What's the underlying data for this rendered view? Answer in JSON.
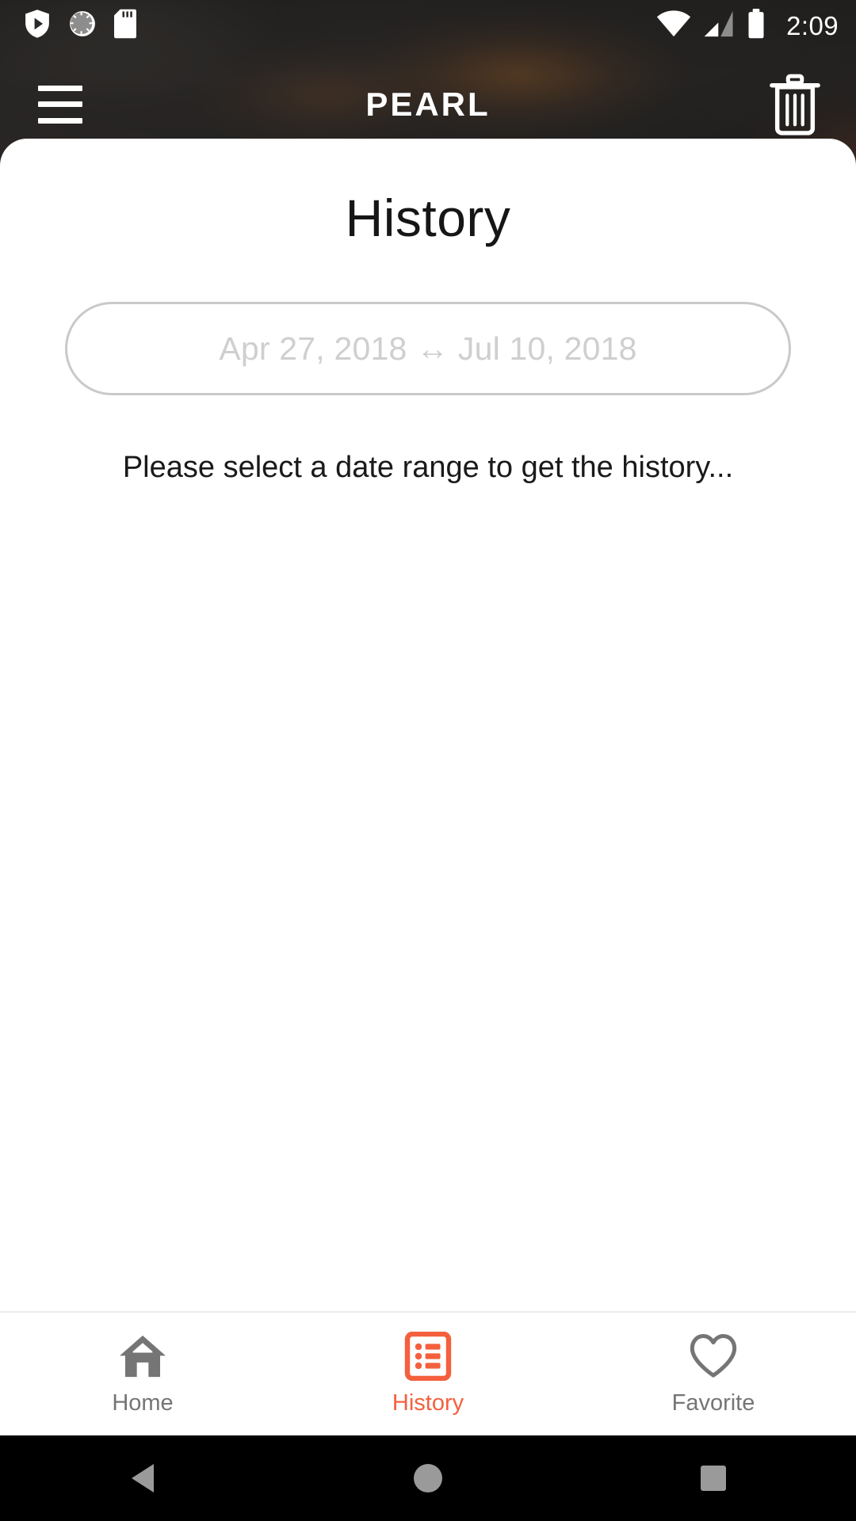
{
  "statusbar": {
    "time": "2:09",
    "icons_left": [
      "play-protect-icon",
      "sync-circle-icon",
      "sd-card-icon"
    ],
    "icons_right": [
      "wifi-icon",
      "cellular-signal-icon",
      "battery-icon"
    ]
  },
  "appbar": {
    "title": "PEARL",
    "menu_icon": "hamburger-menu-icon",
    "delete_icon": "trash-icon"
  },
  "main": {
    "page_title": "History",
    "date_range": {
      "value": "",
      "placeholder": "Apr 27, 2018 ↔ Jul 10, 2018"
    },
    "hint": "Please select a date range to get the history..."
  },
  "bottom_nav": {
    "items": [
      {
        "label": "Home",
        "icon": "home-icon",
        "active": false
      },
      {
        "label": "History",
        "icon": "list-icon",
        "active": true
      },
      {
        "label": "Favorite",
        "icon": "heart-icon",
        "active": false
      }
    ]
  },
  "system_nav": {
    "back": "back-triangle-icon",
    "home": "home-circle-icon",
    "recents": "recents-square-icon"
  },
  "colors": {
    "accent": "#f4603e",
    "header_bg": "#2b2927",
    "text_primary": "#161616",
    "text_muted": "#cfcfcf",
    "nav_inactive": "#757575"
  }
}
